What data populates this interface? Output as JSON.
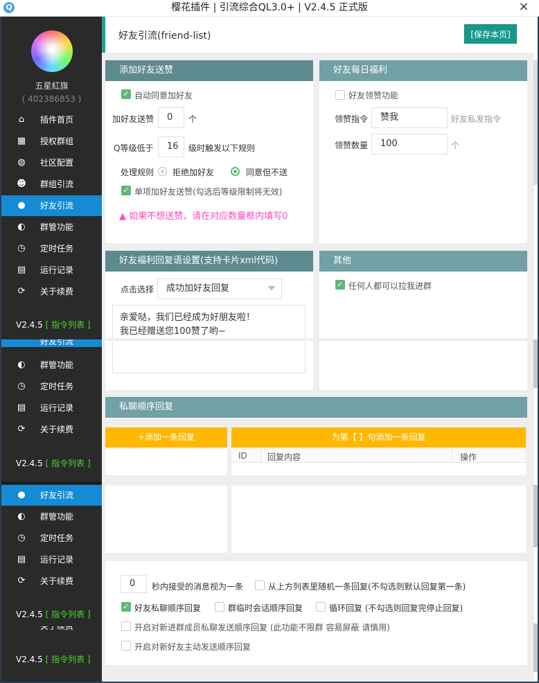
{
  "window": {
    "logo": "Q",
    "title": "樱花插件 | 引流综合QL3.0+ | V2.4.5 正式版",
    "close": "×"
  },
  "user": {
    "name": "五星紅旗",
    "id": "( 402386853 )"
  },
  "nav": [
    {
      "label": "插件首页",
      "icon": "home-icon",
      "glyph": "⌂"
    },
    {
      "label": "授权群组",
      "icon": "grid-icon",
      "glyph": "▦"
    },
    {
      "label": "社区配置",
      "icon": "globe-icon",
      "glyph": "◍"
    },
    {
      "label": "群组引流",
      "icon": "users-icon",
      "glyph": "☻"
    },
    {
      "label": "好友引流",
      "icon": "user-icon",
      "glyph": "●"
    },
    {
      "label": "群管功能",
      "icon": "drupal-icon",
      "glyph": "◐"
    },
    {
      "label": "定时任务",
      "icon": "clock-icon",
      "glyph": "◷"
    },
    {
      "label": "运行记录",
      "icon": "file-icon",
      "glyph": "▤"
    },
    {
      "label": "关于续费",
      "icon": "refresh-icon",
      "glyph": "⟳"
    }
  ],
  "ghost_nav": {
    "partial": "好友引流",
    "partial2": "关于续费",
    "items": [
      "群管功能",
      "定时任务",
      "运行记录",
      "关于续费"
    ],
    "active": "好友引流"
  },
  "version": {
    "text": "V2.4.5",
    "cmd": "[ 指令列表 ]"
  },
  "page": {
    "title": "好友引流(friend-list)",
    "save": "[保存本页]"
  },
  "add_friend": {
    "header": "添加好友送赞",
    "auto_agree": "自动同意加好友",
    "like_label": "加好友送赞",
    "like_value": "0",
    "like_unit": "个",
    "q_label": "Q等级低于",
    "q_value": "16",
    "q_suffix": "级时触发以下规则",
    "rule_label": "处理规则",
    "rule_reject": "拒绝加好友",
    "rule_agree": "同意但不送",
    "single_like": "单项加好友送赞(勾选后等级限制将无效)",
    "warning": "如果不想送赞，请在对应数量框内填写0",
    "warn_icon": "▲"
  },
  "daily": {
    "header": "好友每日福利",
    "receive": "好友领赞功能",
    "cmd_label": "领赞指令",
    "cmd_value": "赞我",
    "cmd_hint": "好友私发指令",
    "count_label": "领赞数量",
    "count_value": "100",
    "count_unit": "个"
  },
  "reply": {
    "header": "好友福利回复语设置(支持卡片xml代码)",
    "select_label": "点击选择",
    "select_value": "成功加好友回复",
    "text_line1": "亲爱哒，我们已经成为好朋友啦！",
    "text_line2": "我已经赠送您100赞了哟~"
  },
  "other": {
    "header": "其他",
    "anyone_invite": "任何人都可以拉我进群"
  },
  "private": {
    "header": "私聊顺序回复",
    "add_btn": "+添加一条回复",
    "add_to_btn": "为第【 】句添加一条回复",
    "col_id": "ID",
    "col_content": "回复内容",
    "col_action": "操作"
  },
  "bottom": {
    "seconds_value": "0",
    "seconds_label": "秒内接受的消息视为一条",
    "random": "从上方列表里随机一条回复(不勾选则默认回复第一条)",
    "friend_seq": "好友私聊顺序回复",
    "group_seq": "群临时会话顺序回复",
    "loop": "循环回复 (不勾选则回复完停止回复)",
    "new_member": "开启对新进群成员私聊发送顺序回复 (此功能不限群 容易屏蔽 请慎用)",
    "new_friend": "开启对新好友主动发送顺序回复"
  },
  "colors": {
    "accent": "#1aa094",
    "nav_active": "#168ad3",
    "header": "#5d8a8f",
    "yellow": "#ffb800",
    "check": "#5fb878",
    "warn": "#ff48c8"
  }
}
